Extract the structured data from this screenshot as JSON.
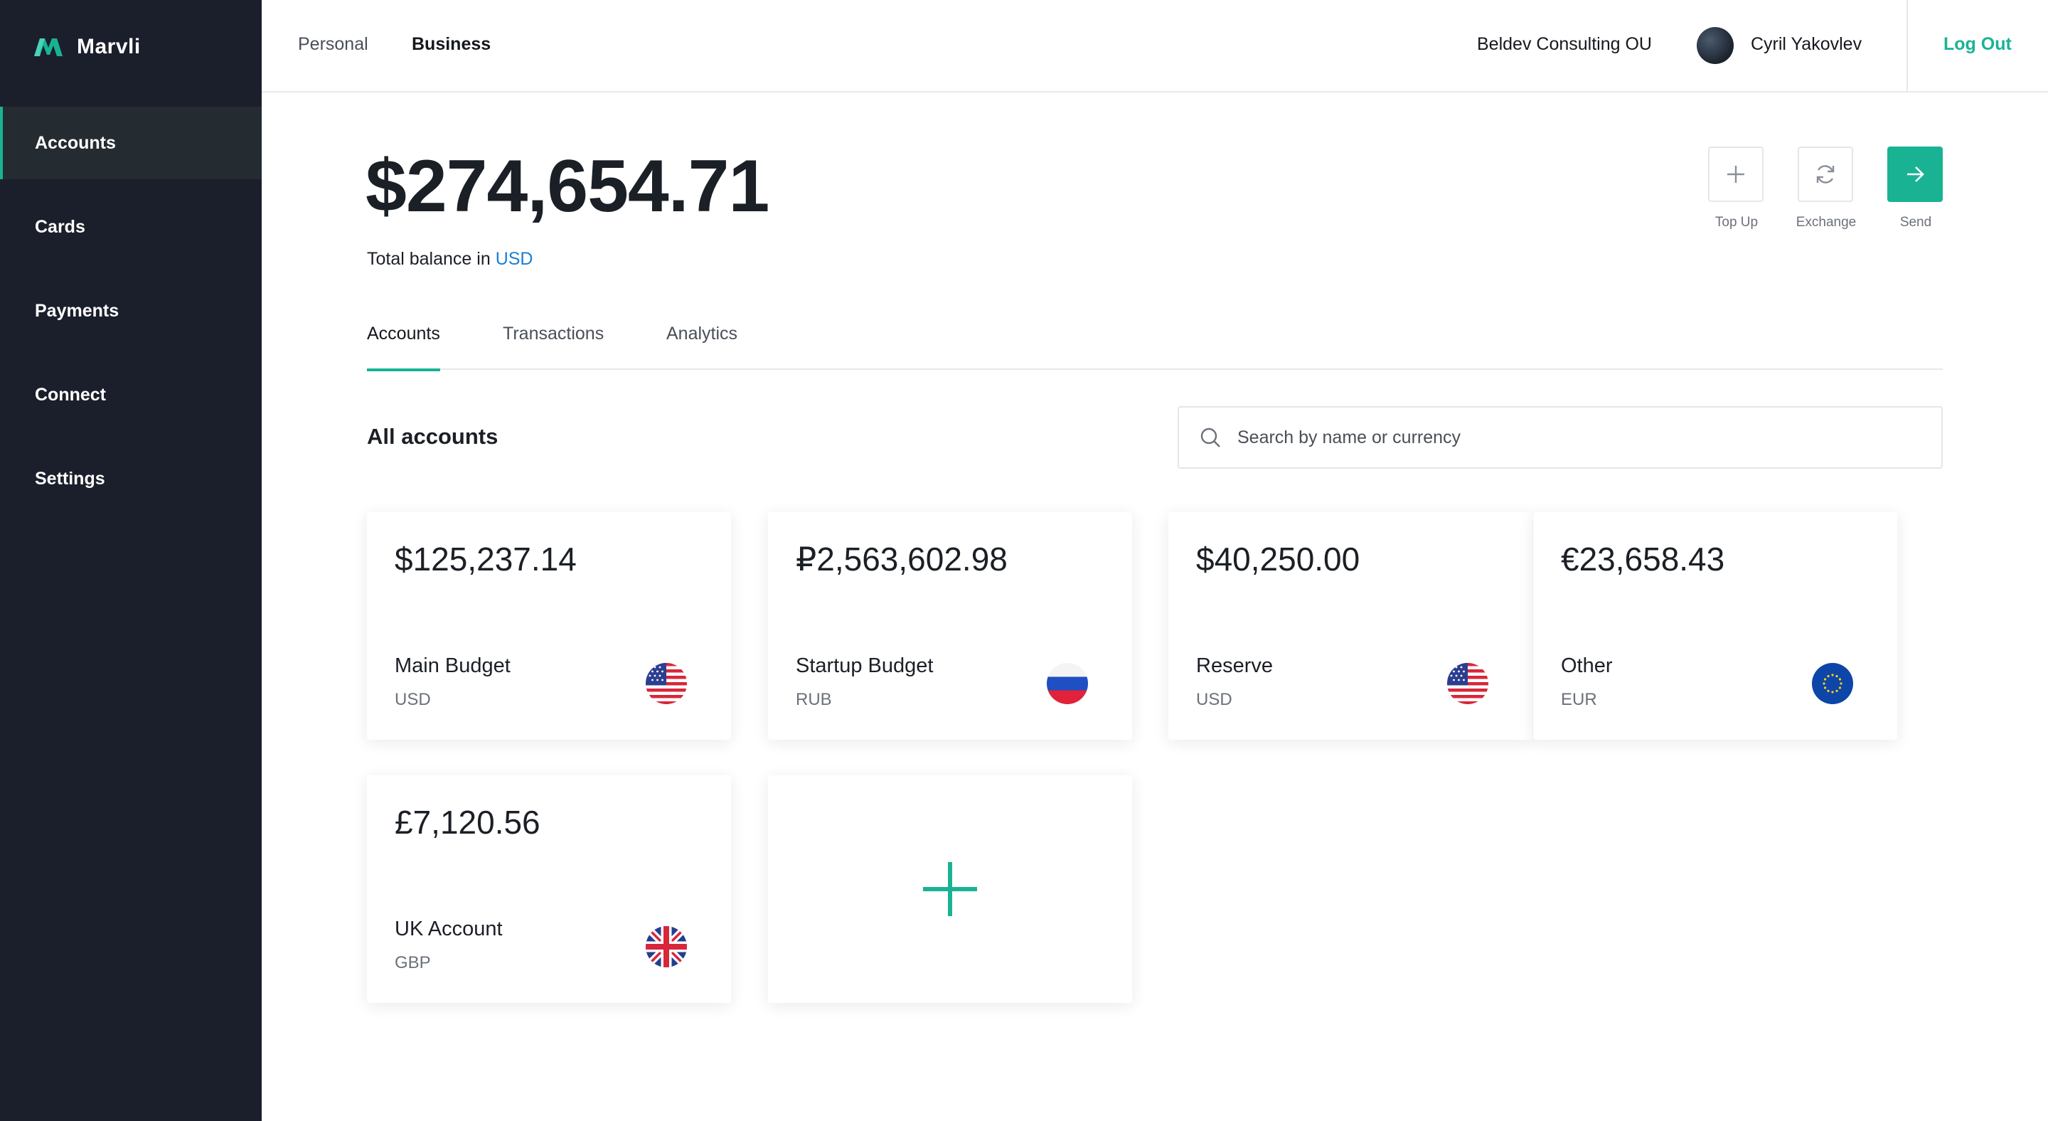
{
  "app": {
    "name": "Marvli",
    "accent_color": "#19b394",
    "sidebar_color": "#1b1f2b"
  },
  "sidebar": {
    "items": [
      {
        "label": "Accounts",
        "active": true
      },
      {
        "label": "Cards",
        "active": false
      },
      {
        "label": "Payments",
        "active": false
      },
      {
        "label": "Connect",
        "active": false
      },
      {
        "label": "Settings",
        "active": false
      }
    ]
  },
  "header": {
    "tabs": [
      {
        "label": "Personal",
        "active": false
      },
      {
        "label": "Business",
        "active": true
      }
    ],
    "company": "Beldev Consulting OU",
    "user_name": "Cyril Yakovlev",
    "logout_label": "Log Out"
  },
  "balance": {
    "amount": "$274,654.71",
    "caption": "Total balance in",
    "currency": "USD"
  },
  "actions": [
    {
      "label": "Top Up",
      "icon": "plus-icon"
    },
    {
      "label": "Exchange",
      "icon": "refresh-icon"
    },
    {
      "label": "Send",
      "icon": "arrow-right-icon"
    }
  ],
  "tabs": [
    {
      "label": "Accounts",
      "active": true
    },
    {
      "label": "Transactions",
      "active": false
    },
    {
      "label": "Analytics",
      "active": false
    }
  ],
  "section": {
    "title": "All accounts",
    "search_placeholder": "Search by name or currency"
  },
  "accounts": [
    {
      "amount": "$125,237.14",
      "name": "Main Budget",
      "currency": "USD",
      "flag": "us-flag-icon"
    },
    {
      "amount": "₽2,563,602.98",
      "name": "Startup Budget",
      "currency": "RUB",
      "flag": "russia-flag-icon"
    },
    {
      "amount": "$40,250.00",
      "name": "Reserve",
      "currency": "USD",
      "flag": "us-flag-icon"
    },
    {
      "amount": "€23,658.43",
      "name": "Other",
      "currency": "EUR",
      "flag": "eu-flag-icon"
    },
    {
      "amount": "£7,120.56",
      "name": "UK Account",
      "currency": "GBP",
      "flag": "uk-flag-icon"
    }
  ],
  "add_account_icon": "plus-icon"
}
